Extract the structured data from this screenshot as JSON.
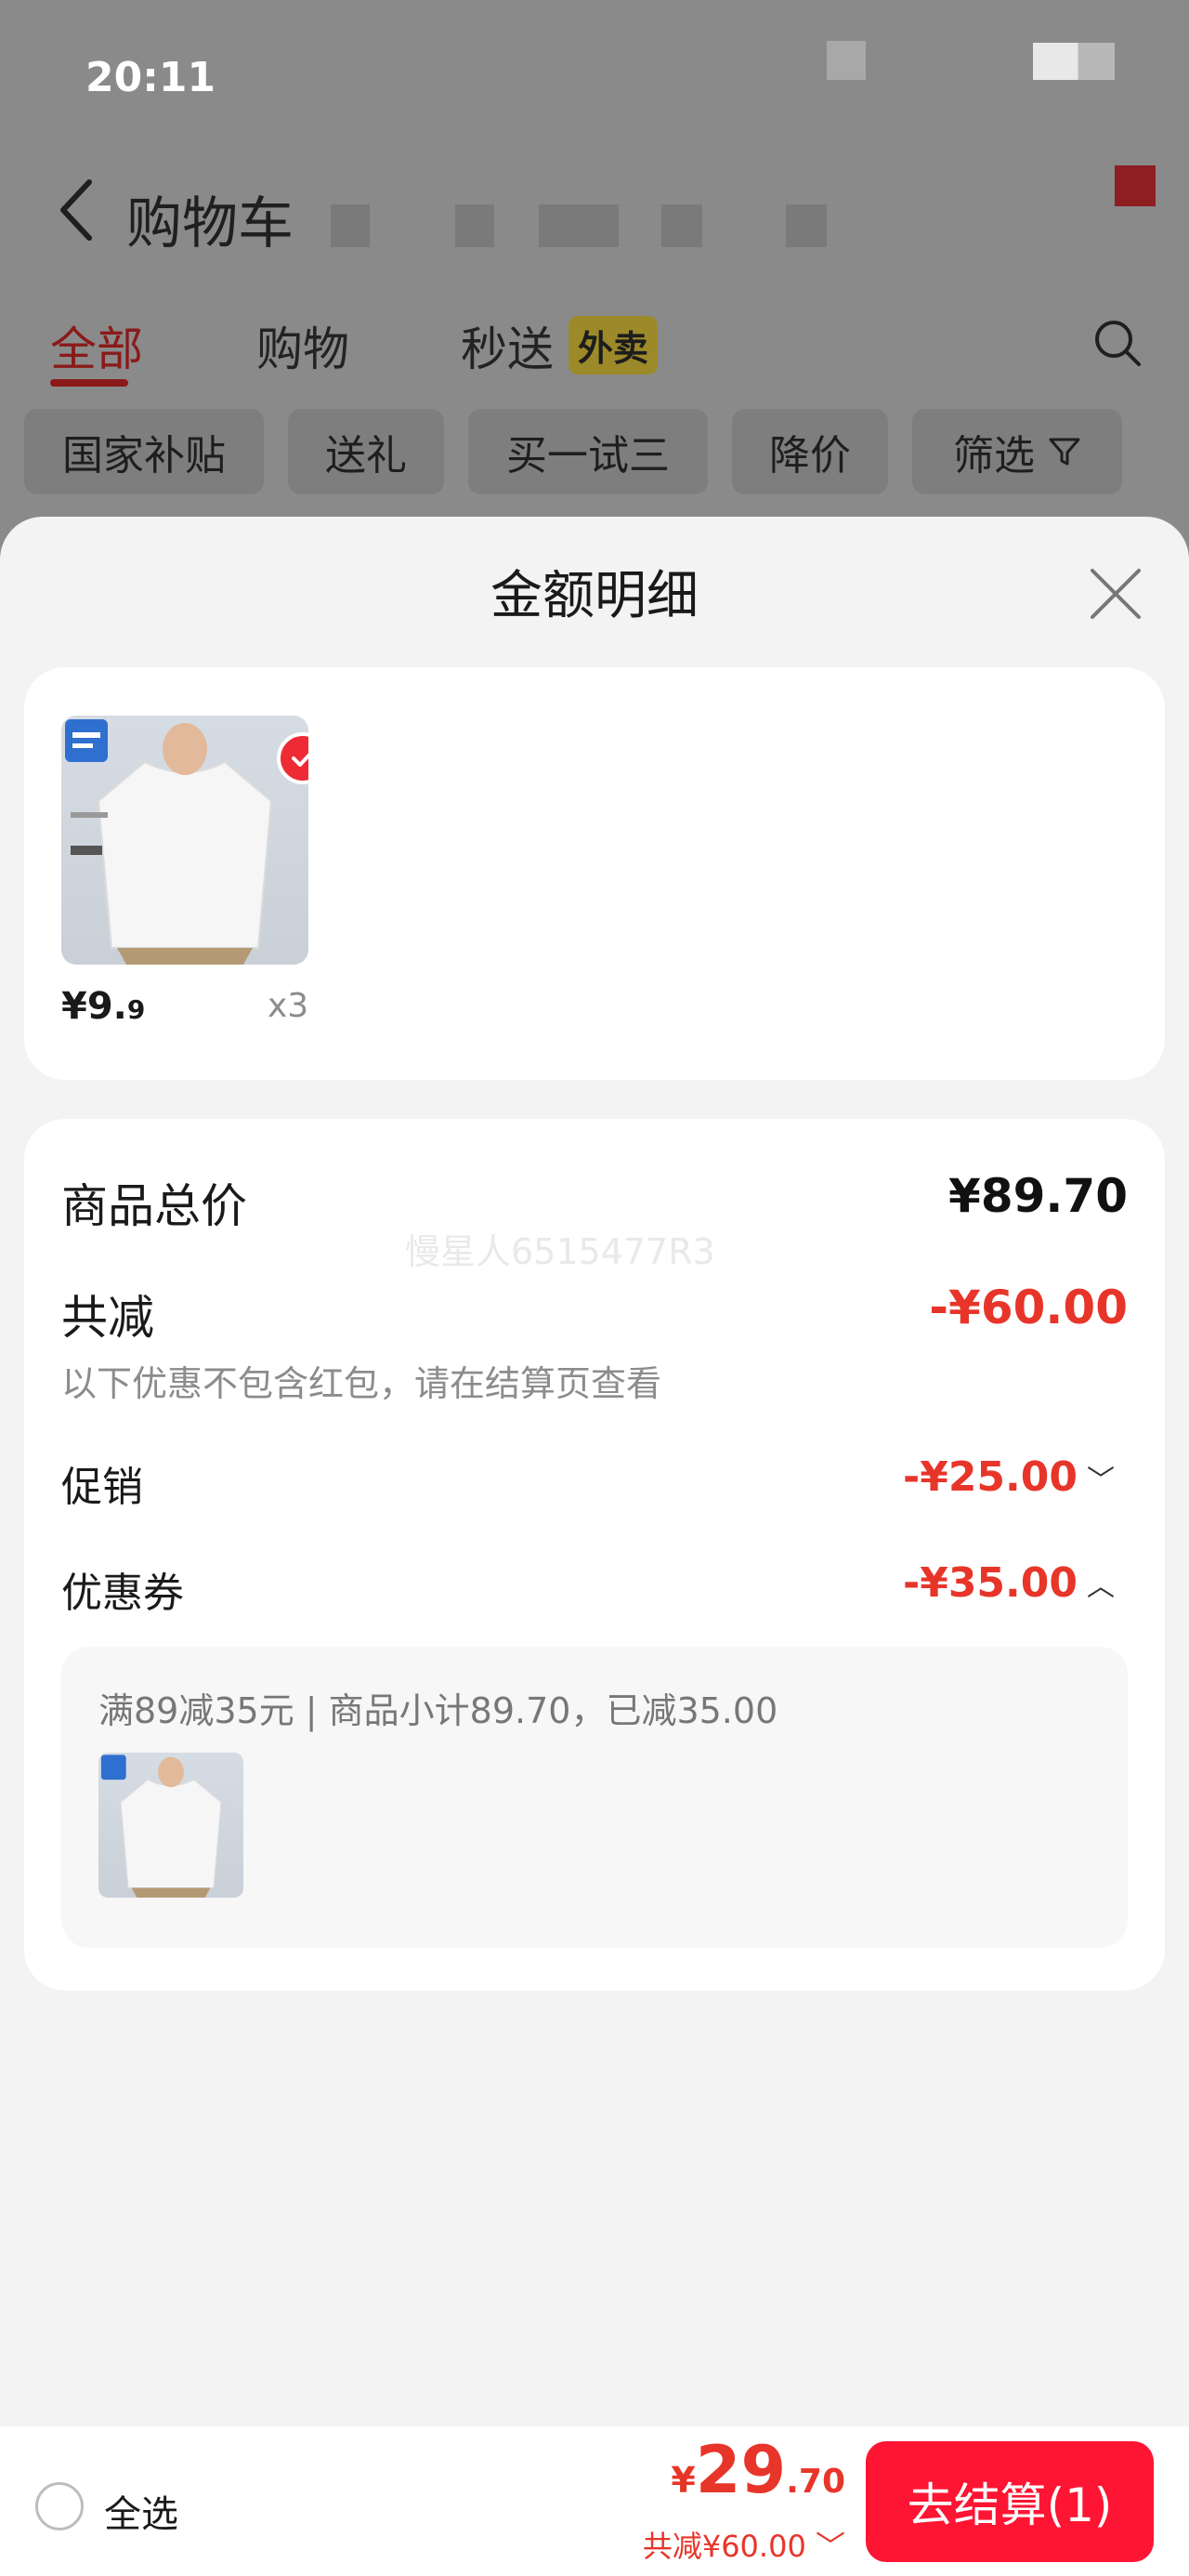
{
  "status_bar": {
    "time": "20:11"
  },
  "background": {
    "title": "购物车",
    "tabs": [
      {
        "label": "全部"
      },
      {
        "label": "购物"
      },
      {
        "label": "秒送"
      }
    ],
    "waimai_badge": "外卖",
    "chips": [
      {
        "label": "国家补贴"
      },
      {
        "label": "送礼"
      },
      {
        "label": "买一试三"
      },
      {
        "label": "降价"
      },
      {
        "label": "筛选"
      }
    ],
    "colors": {
      "accent": "#8a1a1a"
    }
  },
  "sheet": {
    "title": "金额明细",
    "product": {
      "price_int": "¥9.",
      "price_dec": "9",
      "quantity": "x3"
    },
    "summary": {
      "total_label": "商品总价",
      "total_value": "¥89.70",
      "watermark": "慢星人6515477R3",
      "discount_label": "共减",
      "discount_value": "-¥60.00",
      "discount_note": "以下优惠不包含红包，请在结算页查看",
      "promotion_label": "促销",
      "promotion_value": "-¥25.00",
      "coupon_label": "优惠券",
      "coupon_value": "-¥35.00",
      "coupon_detail": "满89减35元 | 商品小计89.70，已减35.00"
    },
    "colors": {
      "discount_red": "#e8352a"
    }
  },
  "bottom_bar": {
    "select_all_label": "全选",
    "total_yen": "¥",
    "total_int": "29",
    "total_dec": ".70",
    "saved_text": "共减¥60.00",
    "checkout_label": "去结算(1)",
    "colors": {
      "checkout_bg": "#fd1533"
    }
  }
}
